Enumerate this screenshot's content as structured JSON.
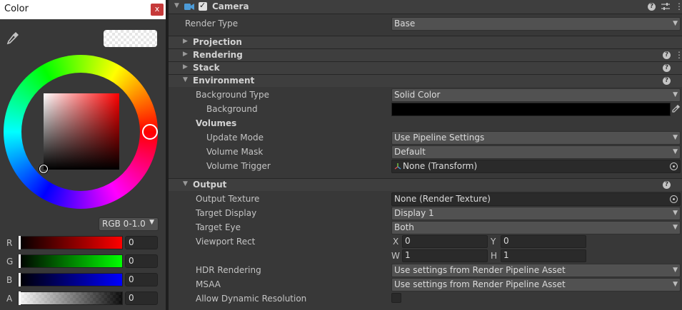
{
  "color_picker": {
    "title": "Color",
    "close_label": "x",
    "mode_label": "RGB 0-1.0",
    "hue_color": "#ff0000",
    "channels": [
      {
        "label": "R",
        "value": "0"
      },
      {
        "label": "G",
        "value": "0"
      },
      {
        "label": "B",
        "value": "0"
      },
      {
        "label": "A",
        "value": "0"
      }
    ],
    "icons": {
      "dropper": "eyedropper-icon",
      "close": "close-icon"
    }
  },
  "inspector": {
    "component_title": "Camera",
    "component_enabled": true,
    "render_type": {
      "label": "Render Type",
      "value": "Base"
    },
    "sections": {
      "projection": "Projection",
      "rendering": "Rendering",
      "stack": "Stack",
      "environment": "Environment",
      "output": "Output"
    },
    "environment": {
      "background_type": {
        "label": "Background Type",
        "value": "Solid Color"
      },
      "background": {
        "label": "Background",
        "color": "#000000"
      },
      "volumes_label": "Volumes",
      "update_mode": {
        "label": "Update Mode",
        "value": "Use Pipeline Settings"
      },
      "volume_mask": {
        "label": "Volume Mask",
        "value": "Default"
      },
      "volume_trigger": {
        "label": "Volume Trigger",
        "value": "None (Transform)"
      }
    },
    "output": {
      "output_texture": {
        "label": "Output Texture",
        "value": "None (Render Texture)"
      },
      "target_display": {
        "label": "Target Display",
        "value": "Display 1"
      },
      "target_eye": {
        "label": "Target Eye",
        "value": "Both"
      },
      "viewport_rect": {
        "label": "Viewport Rect",
        "x_label": "X",
        "x": "0",
        "y_label": "Y",
        "y": "0",
        "w_label": "W",
        "w": "1",
        "h_label": "H",
        "h": "1"
      },
      "hdr_rendering": {
        "label": "HDR Rendering",
        "value": "Use settings from Render Pipeline Asset"
      },
      "msaa": {
        "label": "MSAA",
        "value": "Use settings from Render Pipeline Asset"
      },
      "allow_dynamic_resolution": {
        "label": "Allow Dynamic Resolution",
        "checked": false
      }
    },
    "help_glyph": "?",
    "menu_glyph": "⋮"
  }
}
